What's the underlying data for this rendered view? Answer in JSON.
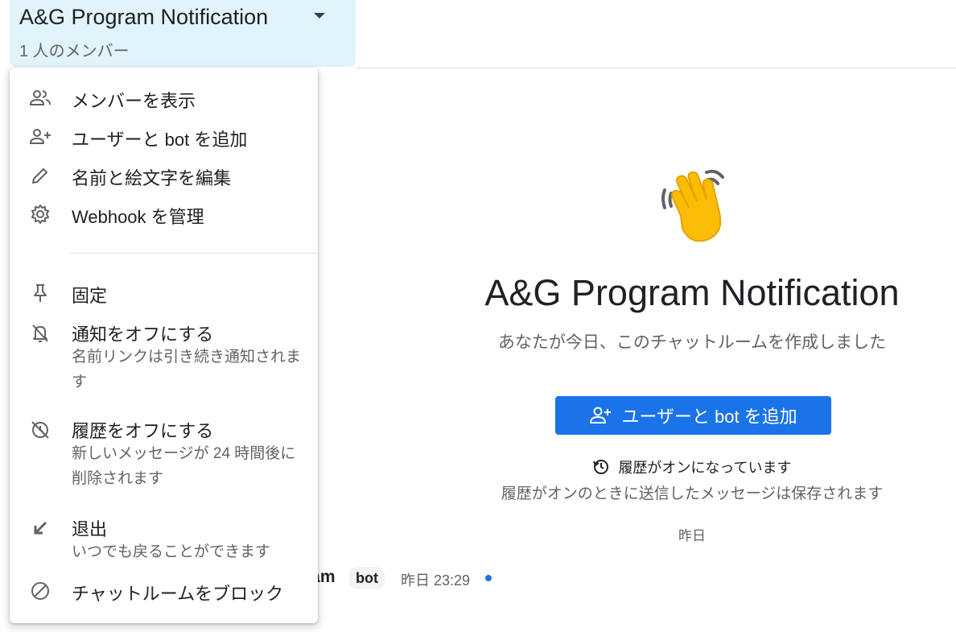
{
  "header": {
    "title": "A&G Program Notification",
    "member_count": "1 人のメンバー"
  },
  "menu": {
    "view_members": "メンバーを表示",
    "add_users_bots": "ユーザーと bot を追加",
    "edit_name_emoji": "名前と絵文字を編集",
    "manage_webhooks": "Webhook を管理",
    "pin": "固定",
    "notifications_off": "通知をオフにする",
    "notifications_off_desc": "名前リンクは引き続き通知されます",
    "history_off": "履歴をオフにする",
    "history_off_desc": "新しいメッセージが 24 時間後に削除されます",
    "leave": "退出",
    "leave_desc": "いつでも戻ることができます",
    "block": "チャットルームをブロック"
  },
  "main": {
    "title": "A&G Program Notification",
    "subtitle": "あなたが今日、このチャットルームを作成しました",
    "add_button": "ユーザーと bot を追加",
    "history_status": "履歴がオンになっています",
    "history_desc": "履歴がオンのときに送信したメッセージは保存されます",
    "date_separator": "昨日"
  },
  "message": {
    "sender_partial": "ram",
    "badge": "bot",
    "time": "昨日 23:29"
  },
  "colors": {
    "accent": "#1a73e8",
    "header_bg": "#e1f3fb",
    "icon": "#5f6368"
  }
}
